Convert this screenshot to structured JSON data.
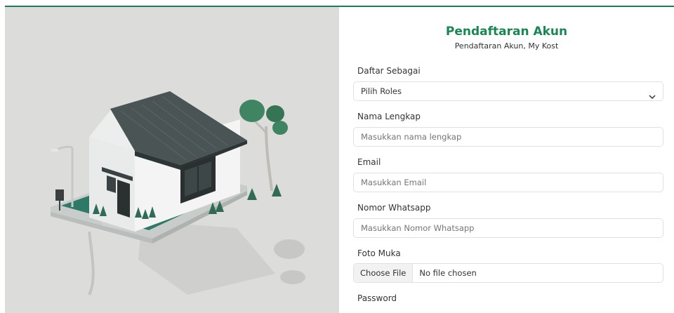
{
  "form": {
    "title": "Pendaftaran Akun",
    "subtitle": "Pendaftaran Akun, My Kost",
    "role_label": "Daftar Sebagai",
    "role_value": "Pilih Roles",
    "name_label": "Nama Lengkap",
    "name_placeholder": "Masukkan nama lengkap",
    "email_label": "Email",
    "email_placeholder": "Masukkan Email",
    "whatsapp_label": "Nomor Whatsapp",
    "whatsapp_placeholder": "Masukkan Nomor Whatsapp",
    "photo_label": "Foto Muka",
    "file_button": "Choose File",
    "file_status": "No file chosen",
    "password_label": "Password"
  },
  "colors": {
    "accent": "#198754",
    "top_border": "#1d7a5c",
    "illustration_bg": "#dcdcdb"
  },
  "icons": {
    "select_chevron": "chevron-down-icon"
  }
}
